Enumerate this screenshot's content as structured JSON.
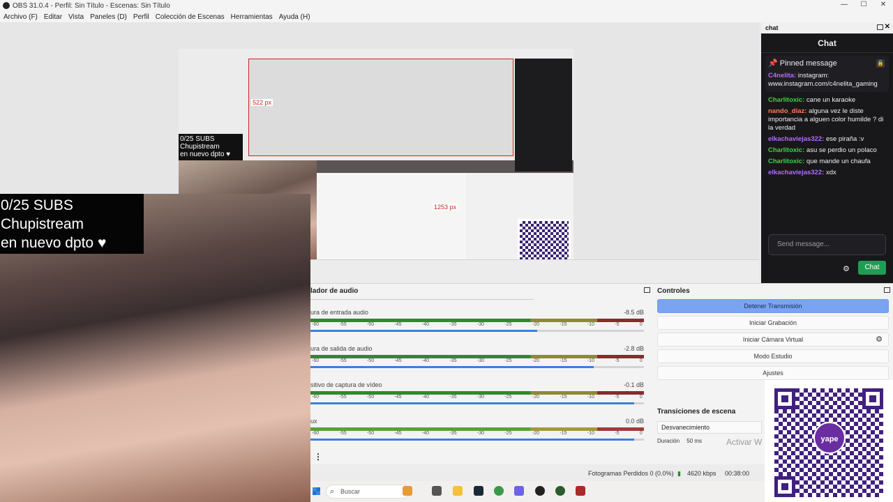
{
  "window": {
    "title": "OBS 31.0.4 - Perfil: Sin Título - Escenas: Sin Título",
    "controls": [
      "—",
      "☐",
      "✕"
    ]
  },
  "menu": [
    "Archivo (F)",
    "Editar",
    "Vista",
    "Paneles (D)",
    "Perfil",
    "Colección de Escenas",
    "Herramientas",
    "Ayuda (H)"
  ],
  "overlay": {
    "subs_line1": "0/25 SUBS",
    "subs_line2": "Chupistream",
    "subs_line3": "en nuevo dpto ♥",
    "px_label_1": "522 px",
    "px_label_2": "1253 px"
  },
  "audio_mixer": {
    "title": "lador de audio",
    "scale": [
      "-60",
      "-55",
      "-50",
      "-45",
      "-40",
      "-35",
      "-30",
      "-25",
      "-20",
      "-15",
      "-10",
      "-5",
      "0"
    ],
    "channels": [
      {
        "name": "ura de entrada audio",
        "db": "-8.5 dB",
        "fader": 0.68
      },
      {
        "name": "ura de salida de audio",
        "db": "-2.8 dB",
        "fader": 0.85
      },
      {
        "name": "sitivo de captura de vídeo",
        "db": "-0.1 dB",
        "fader": 0.97
      },
      {
        "name": "ux",
        "db": "0.0 dB",
        "fader": 0.97
      }
    ]
  },
  "controls": {
    "title": "Controles",
    "buttons": [
      "Detener Transmisión",
      "Iniciar Grabación",
      "Iniciar Cámara Virtual",
      "Modo Estudio",
      "Ajustes"
    ]
  },
  "transitions": {
    "title": "Transiciones de escena",
    "selected": "Desvanecimiento",
    "duration_label": "Duración",
    "duration_value": "50 ms"
  },
  "watermark": "Activar W",
  "status": {
    "dropped": "Fotogramas Perdidos 0 (0.0%)",
    "bitrate": "4620 kbps",
    "time": "00:38:00"
  },
  "taskbar": {
    "search_placeholder": "Buscar"
  },
  "chat": {
    "dock_title": "chat",
    "title": "Chat",
    "pinned_title": "Pinned message",
    "pinned_user": "C4nelita:",
    "pinned_text": "instagram: www.instagram.com/c4nelita_gaming",
    "messages": [
      {
        "user": "Charlitoxic:",
        "text": "cane un karaoke",
        "color": "#3cd34a"
      },
      {
        "user": "nando_diaz:",
        "text": "alguna vez le diste importancia a alguen color humilde ? di la verdad",
        "color": "#ff7f50"
      },
      {
        "user": "elkachaviejas322:",
        "text": "ese piraña :v",
        "color": "#b46bff"
      },
      {
        "user": "Charlitoxic:",
        "text": "asu se perdio un polaco",
        "color": "#3cd34a"
      },
      {
        "user": "Charlitoxic:",
        "text": "que mande un chaufa",
        "color": "#3cd34a"
      },
      {
        "user": "elkachaviejas322:",
        "text": "xdx",
        "color": "#b46bff"
      }
    ],
    "input_placeholder": "Send message...",
    "send_label": "Chat"
  },
  "qr": {
    "brand": "yape"
  }
}
